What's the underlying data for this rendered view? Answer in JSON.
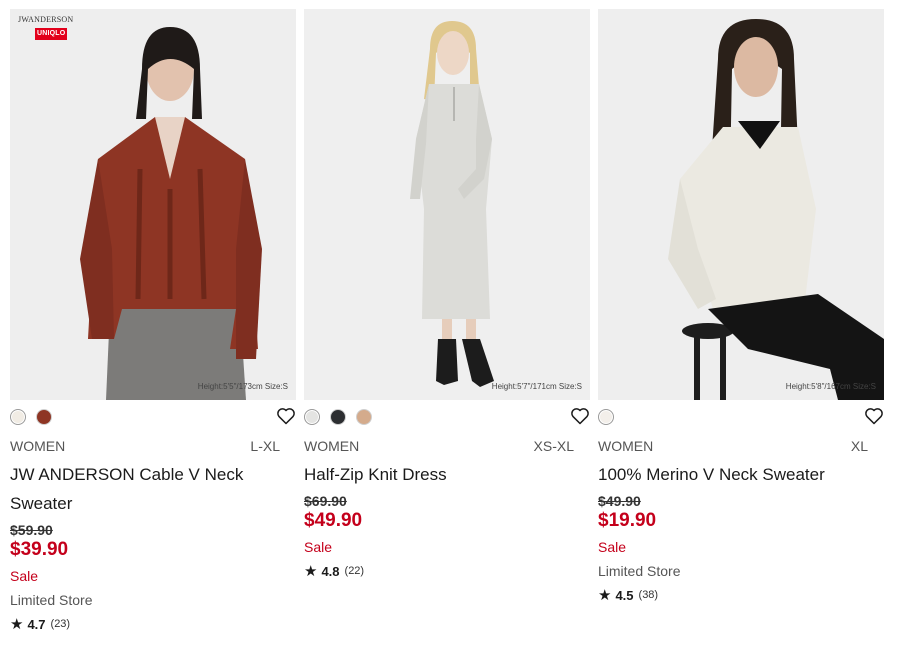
{
  "products": [
    {
      "brand_logo": "JWANDERSON",
      "brand_badge": "UNIQLO",
      "size_note": "Height:5'5\"/173cm  Size:S",
      "swatches": [
        "#f1ece4",
        "#8e3524"
      ],
      "gender": "WOMEN",
      "sizes": "L-XL",
      "name": "JW ANDERSON Cable V Neck Sweater",
      "original_price": "$59.90",
      "price": "$39.90",
      "sale": "Sale",
      "store": "Limited Store",
      "rating": "4.7",
      "reviews": "(23)"
    },
    {
      "size_note": "Height:5'7\"/171cm  Size:S",
      "swatches": [
        "#e4e4e2",
        "#2c2e31",
        "#d4ab8c"
      ],
      "gender": "WOMEN",
      "sizes": "XS-XL",
      "name": "Half-Zip Knit Dress",
      "original_price": "$69.90",
      "price": "$49.90",
      "sale": "Sale",
      "rating": "4.8",
      "reviews": "(22)"
    },
    {
      "size_note": "Height:5'8\"/167cm  Size:S",
      "swatches": [
        "#f3efea"
      ],
      "gender": "WOMEN",
      "sizes": "XL",
      "name": "100% Merino V Neck Sweater",
      "original_price": "$49.90",
      "price": "$19.90",
      "sale": "Sale",
      "store": "Limited Store",
      "rating": "4.5",
      "reviews": "(38)"
    }
  ],
  "icons": {
    "favorite": "heart-outline-icon",
    "rating": "star-icon"
  },
  "colors": {
    "sale_red": "#c4001b",
    "text": "#1b1b1b",
    "muted": "#555555"
  }
}
